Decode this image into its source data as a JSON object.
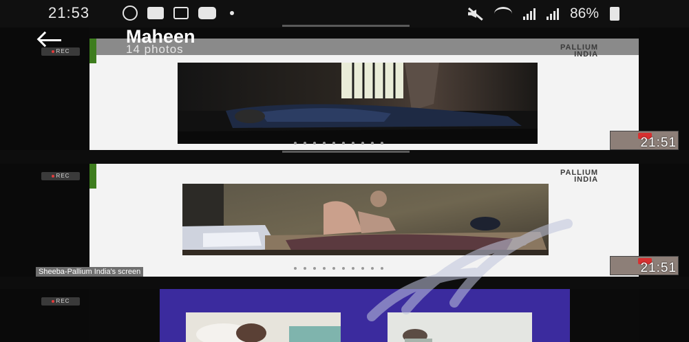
{
  "status_bar": {
    "time": "21:53",
    "battery": "86%",
    "left_icons": [
      "whatsapp-icon",
      "message-icon",
      "b-app-icon",
      "youtube-icon",
      "notification-dot-icon"
    ],
    "right_icons": [
      "mute-icon",
      "wifi-icon",
      "signal-icon",
      "signal-icon",
      "battery-icon"
    ]
  },
  "header": {
    "title": "Maheen",
    "subtitle": "14 photos"
  },
  "logo": {
    "line1": "PALLIUM",
    "line2": "INDIA"
  },
  "rec_label": "REC",
  "thumbnail_time": "21:51",
  "screen_share_label": "Sheeba-Pallium India's screen",
  "colors": {
    "slide_accent": "#3e7d1e",
    "slide_background": "#f3f3f3",
    "purple_slide": "#3b2b9e"
  }
}
